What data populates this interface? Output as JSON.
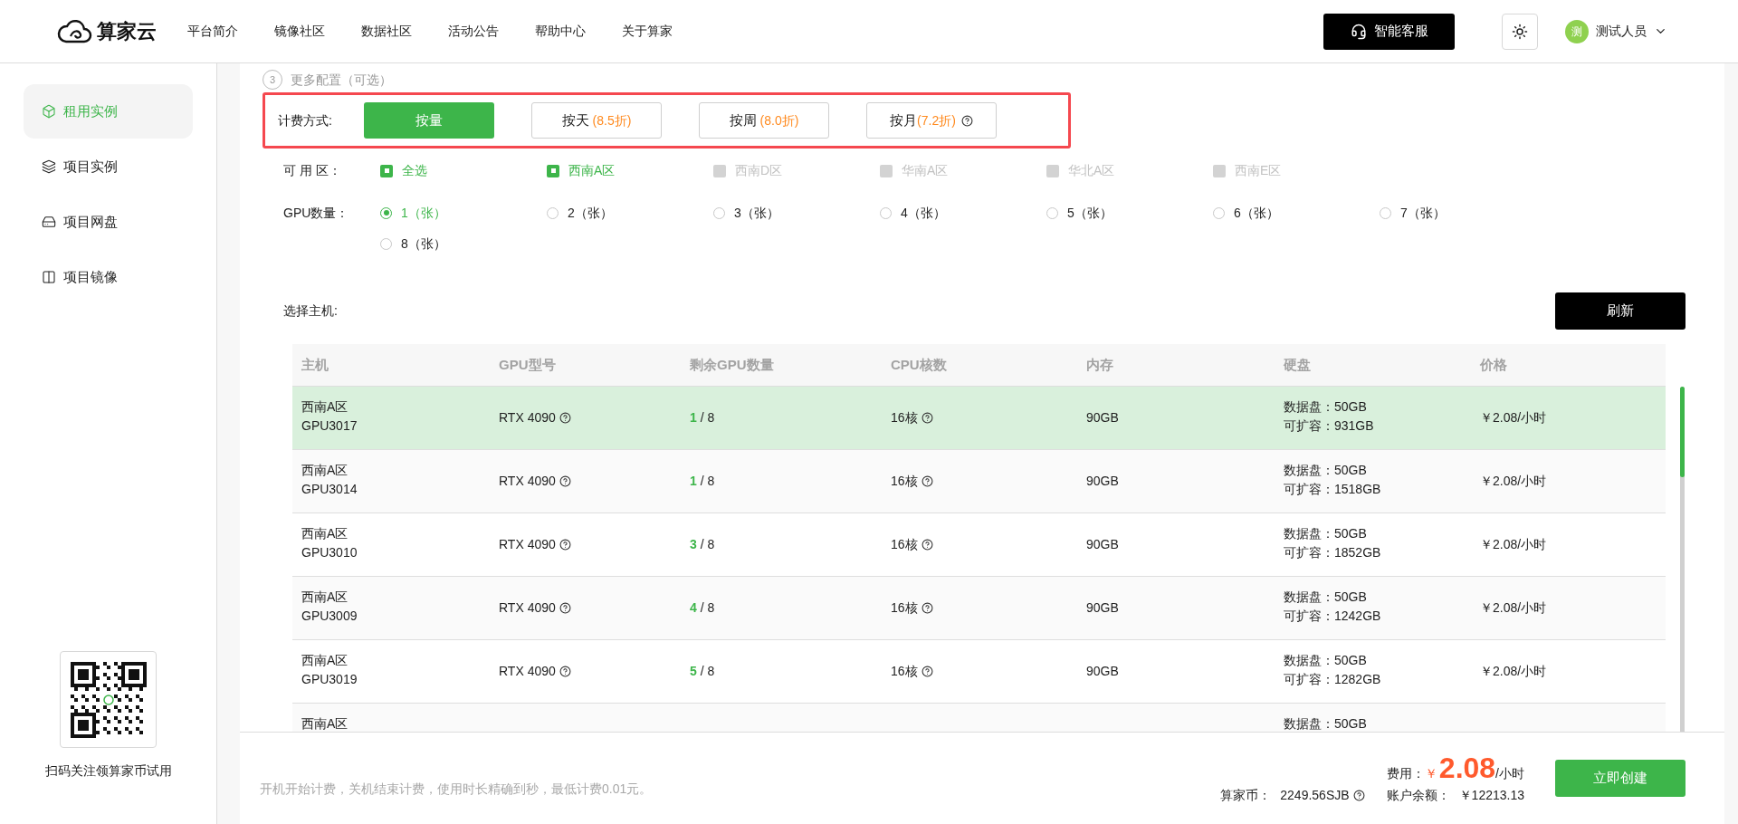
{
  "header": {
    "brand": "算家云",
    "nav": [
      {
        "label": "平台简介"
      },
      {
        "label": "镜像社区"
      },
      {
        "label": "数据社区"
      },
      {
        "label": "活动公告"
      },
      {
        "label": "帮助中心"
      },
      {
        "label": "关于算家"
      }
    ],
    "service_button": "智能客服",
    "user": {
      "avatar": "测",
      "name": "测试人员"
    }
  },
  "sidebar": {
    "items": [
      {
        "label": "租用实例",
        "kind": "box",
        "selected": true
      },
      {
        "label": "项目实例",
        "kind": "layers",
        "selected": false
      },
      {
        "label": "项目网盘",
        "kind": "disk",
        "selected": false
      },
      {
        "label": "项目镜像",
        "kind": "image",
        "selected": false
      }
    ],
    "promo": "扫码关注领算家币试用"
  },
  "step": {
    "number": "3",
    "title": "更多配置（可选）"
  },
  "billing": {
    "label": "计费方式:",
    "options": [
      {
        "label": "按量",
        "selected": true
      },
      {
        "label": "按天",
        "discount": "(8.5折)",
        "selected": false
      },
      {
        "label": "按周",
        "discount": "(8.0折)",
        "selected": false
      },
      {
        "label": "按月",
        "discount": "(7.2折)",
        "help": true,
        "selected": false
      }
    ]
  },
  "zones": {
    "label": "可 用 区：",
    "options": [
      {
        "label": "全选",
        "checked": true,
        "disabled": false
      },
      {
        "label": "西南A区",
        "checked": true,
        "disabled": false
      },
      {
        "label": "西南D区",
        "checked": false,
        "disabled": true
      },
      {
        "label": "华南A区",
        "checked": false,
        "disabled": true
      },
      {
        "label": "华北A区",
        "checked": false,
        "disabled": true
      },
      {
        "label": "西南E区",
        "checked": false,
        "disabled": true
      }
    ]
  },
  "gpu_count": {
    "label": "GPU数量：",
    "options": [
      {
        "label": "1（张）",
        "selected": true
      },
      {
        "label": "2（张）",
        "selected": false
      },
      {
        "label": "3（张）",
        "selected": false
      },
      {
        "label": "4（张）",
        "selected": false
      },
      {
        "label": "5（张）",
        "selected": false
      },
      {
        "label": "6（张）",
        "selected": false
      },
      {
        "label": "7（张）",
        "selected": false
      },
      {
        "label": "8（张）",
        "selected": false
      }
    ]
  },
  "host_select": {
    "label": "选择主机:",
    "refresh_button": "刷新"
  },
  "table": {
    "columns": [
      "主机",
      "GPU型号",
      "剩余GPU数量",
      "CPU核数",
      "内存",
      "硬盘",
      "价格"
    ],
    "rows": [
      {
        "region": "西南A区",
        "host": "GPU3017",
        "gpu": "RTX 4090",
        "remaining": "1",
        "total": "/ 8",
        "cpu": "16核",
        "memory": "90GB",
        "disk": "数据盘：50GB",
        "expand": "可扩容：931GB",
        "price": "￥2.08/小时",
        "selected": true
      },
      {
        "region": "西南A区",
        "host": "GPU3014",
        "gpu": "RTX 4090",
        "remaining": "1",
        "total": "/ 8",
        "cpu": "16核",
        "memory": "90GB",
        "disk": "数据盘：50GB",
        "expand": "可扩容：1518GB",
        "price": "￥2.08/小时",
        "selected": false
      },
      {
        "region": "西南A区",
        "host": "GPU3010",
        "gpu": "RTX 4090",
        "remaining": "3",
        "total": "/ 8",
        "cpu": "16核",
        "memory": "90GB",
        "disk": "数据盘：50GB",
        "expand": "可扩容：1852GB",
        "price": "￥2.08/小时",
        "selected": false
      },
      {
        "region": "西南A区",
        "host": "GPU3009",
        "gpu": "RTX 4090",
        "remaining": "4",
        "total": "/ 8",
        "cpu": "16核",
        "memory": "90GB",
        "disk": "数据盘：50GB",
        "expand": "可扩容：1242GB",
        "price": "￥2.08/小时",
        "selected": false
      },
      {
        "region": "西南A区",
        "host": "GPU3019",
        "gpu": "RTX 4090",
        "remaining": "5",
        "total": "/ 8",
        "cpu": "16核",
        "memory": "90GB",
        "disk": "数据盘：50GB",
        "expand": "可扩容：1282GB",
        "price": "￥2.08/小时",
        "selected": false
      },
      {
        "region": "西南A区",
        "disk": "数据盘：50GB",
        "selected": false
      }
    ]
  },
  "footer": {
    "note": "开机开始计费，关机结束计费，使用时长精确到秒，最低计费0.01元。",
    "fee_label": "费用：",
    "currency": "￥",
    "fee": "2.08",
    "unit": "/小时",
    "coins_label": "算家币：",
    "coins": "2249.56SJB",
    "balance_label": "账户余额：",
    "balance": "￥12213.13",
    "create_button": "立即创建"
  }
}
